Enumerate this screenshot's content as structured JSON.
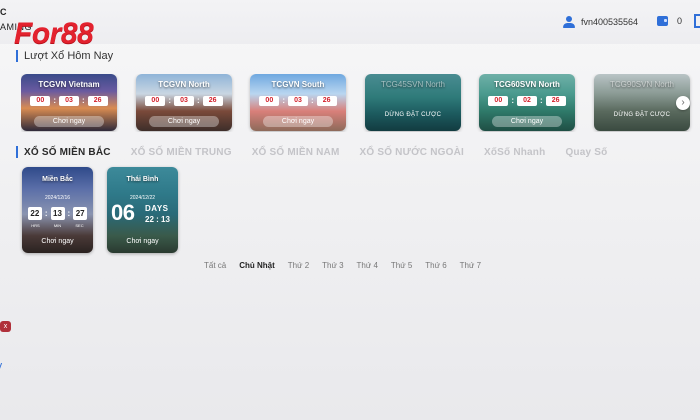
{
  "header": {
    "brand_small_top": "C",
    "brand_small_bottom": "AMING",
    "logo_text": "For88",
    "username": "fvn400535564",
    "balance": "0",
    "accent": "#2f6fd8",
    "logo_color": "#e3222e",
    "icons": {
      "user": "user-icon",
      "wallet": "wallet-icon"
    }
  },
  "today": {
    "title": "Lượt Xổ Hôm Nay",
    "cards": [
      {
        "title": "TCGVN Vietnam",
        "h": "00",
        "m": "03",
        "s": "26",
        "play": "Chơi ngay",
        "theme": "dragon-bridge"
      },
      {
        "title": "TCGVN North",
        "h": "00",
        "m": "03",
        "s": "26",
        "play": "Chơi ngay",
        "theme": "pagoda"
      },
      {
        "title": "TCGVN South",
        "h": "00",
        "m": "03",
        "s": "26",
        "play": "Chơi ngay",
        "theme": "cathedral"
      },
      {
        "title": "TCG45SVN North",
        "status": "DỪNG ĐẶT CƯỢC",
        "theme": "bay"
      },
      {
        "title": "TCG60SVN North",
        "h": "00",
        "m": "02",
        "s": "26",
        "play": "Chơi ngay",
        "theme": "ha-long"
      },
      {
        "title": "TCG90SVN North",
        "status": "DỪNG ĐẶT CƯỢC",
        "theme": "rocks"
      }
    ],
    "next_glyph": "›"
  },
  "tabs": [
    {
      "label": "XỔ SỐ MIỀN BẮC",
      "active": true
    },
    {
      "label": "XỔ SỐ MIỀN TRUNG",
      "active": false
    },
    {
      "label": "XỔ SỐ MIỀN NAM",
      "active": false
    },
    {
      "label": "XỔ SỐ NƯỚC NGOÀI",
      "active": false
    },
    {
      "label": "XốSố Nhanh",
      "active": false
    },
    {
      "label": "Quay Số",
      "active": false
    }
  ],
  "regional": [
    {
      "title": "Miền Bắc",
      "date": "2024/12/16",
      "h": "22",
      "m": "13",
      "s": "27",
      "units": [
        "HRS",
        "MIN",
        "SEC"
      ],
      "play": "Chơi ngay"
    },
    {
      "title": "Thái Bình",
      "date": "2024/12/22",
      "days": "06",
      "days_label": "DAYS",
      "time": "22 : 13",
      "play": "Chơi ngay"
    }
  ],
  "days_filter": [
    {
      "label": "Tất cả",
      "active": false
    },
    {
      "label": "Chủ Nhật",
      "active": true
    },
    {
      "label": "Thứ 2",
      "active": false
    },
    {
      "label": "Thứ 3",
      "active": false
    },
    {
      "label": "Thứ 4",
      "active": false
    },
    {
      "label": "Thứ 5",
      "active": false
    },
    {
      "label": "Thứ 6",
      "active": false
    },
    {
      "label": "Thứ 7",
      "active": false
    }
  ],
  "misc": {
    "close_glyph": "x"
  }
}
